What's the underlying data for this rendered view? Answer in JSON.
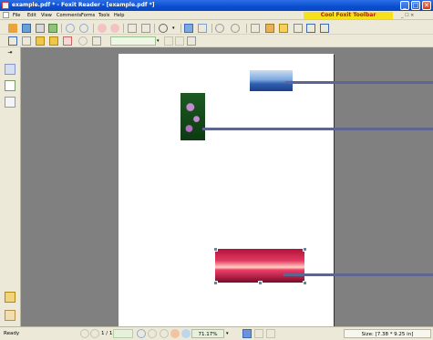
{
  "window": {
    "title": "example.pdf * - Foxit Reader - [example.pdf *]",
    "minimize_glyph": "_",
    "maximize_glyph": "□",
    "close_glyph": "✕"
  },
  "menu": {
    "items": [
      "File",
      "Edit",
      "View",
      "Comments",
      "Forms",
      "Tools",
      "Help"
    ],
    "promo": "Cool Foxit Toolbar",
    "mdi_controls": "_ ☐ ×"
  },
  "toolbar": {
    "zoom_placeholder": ""
  },
  "document": {
    "images": [
      {
        "name": "mountain-lake-image",
        "colors": [
          "#1b3f8a",
          "#5c8fd6",
          "#c9ddf2"
        ]
      },
      {
        "name": "flower-plant-image",
        "colors": [
          "#0d3a12",
          "#2e7d32",
          "#c48bd0"
        ]
      },
      {
        "name": "sunset-image",
        "colors": [
          "#b3123a",
          "#ef3f6a",
          "#ffd1c2"
        ]
      }
    ],
    "connector_color": "#5d6590"
  },
  "status": {
    "ready": "Ready",
    "page": "1 / 1",
    "zoom": "71.17%",
    "size": "Size: [7.38 * 9.25 in]"
  },
  "colors": {
    "titlebar": "#0a4fd0",
    "workspace": "#808080",
    "chrome": "#ece9d8",
    "promo_bg": "#f6e21c",
    "promo_fg": "#c0131b"
  }
}
